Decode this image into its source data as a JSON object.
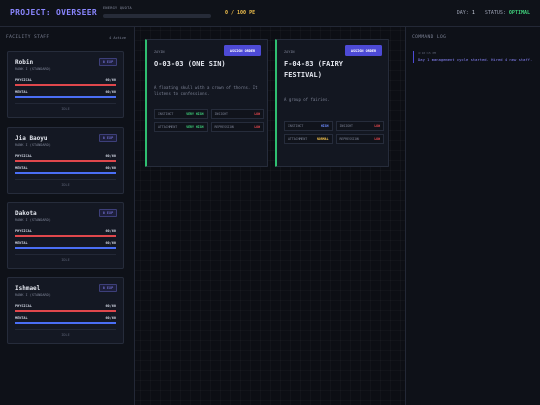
{
  "header": {
    "title": "PROJECT: OVERSEER",
    "quota_label": "ENERGY QUOTA",
    "quota_value": "0 / 100 PE",
    "quota_fraction": 0.0,
    "day_label": "DAY:",
    "day_value": "1",
    "status_label": "STATUS:",
    "status_value": "OPTIMAL"
  },
  "staff": {
    "heading": "FACILITY STAFF",
    "count": "4 Active",
    "members": [
      {
        "name": "Robin",
        "rank": "RANK I (STANDARD)",
        "exp": "0 EXP",
        "physical_label": "PHYSICAL",
        "physical": "60/60",
        "mental_label": "MENTAL",
        "mental": "60/60",
        "footer": "IDLE"
      },
      {
        "name": "Jia Baoyu",
        "rank": "RANK I (STANDARD)",
        "exp": "0 EXP",
        "physical_label": "PHYSICAL",
        "physical": "60/60",
        "mental_label": "MENTAL",
        "mental": "60/60",
        "footer": "IDLE"
      },
      {
        "name": "Dakota",
        "rank": "RANK I (STANDARD)",
        "exp": "0 EXP",
        "physical_label": "PHYSICAL",
        "physical": "60/60",
        "mental_label": "MENTAL",
        "mental": "60/60",
        "footer": "IDLE"
      },
      {
        "name": "Ishmael",
        "rank": "RANK I (STANDARD)",
        "exp": "0 EXP",
        "physical_label": "PHYSICAL",
        "physical": "60/60",
        "mental_label": "MENTAL",
        "mental": "60/60",
        "footer": "IDLE"
      }
    ]
  },
  "abnormalities": [
    {
      "tag": "ZAYIN",
      "assign_label": "ASSIGN ORDER",
      "name": "O-03-03 (ONE SIN)",
      "description": "A floating skull with a crown of thorns. It listens to confessions.",
      "work": [
        {
          "label": "INSTINCT",
          "value": "VERY HIGH",
          "tone": "g"
        },
        {
          "label": "INSIGHT",
          "value": "LOW",
          "tone": "r"
        },
        {
          "label": "ATTACHMENT",
          "value": "VERY HIGH",
          "tone": "g"
        },
        {
          "label": "REPRESSION",
          "value": "LOW",
          "tone": "r"
        }
      ]
    },
    {
      "tag": "ZAYIN",
      "assign_label": "ASSIGN ORDER",
      "name": "F-04-83 (FAIRY FESTIVAL)",
      "description": "A group of fairies.",
      "work": [
        {
          "label": "INSTINCT",
          "value": "HIGH",
          "tone": "b"
        },
        {
          "label": "INSIGHT",
          "value": "LOW",
          "tone": "r"
        },
        {
          "label": "ATTACHMENT",
          "value": "NORMAL",
          "tone": "y"
        },
        {
          "label": "REPRESSION",
          "value": "LOW",
          "tone": "r"
        }
      ]
    }
  ],
  "log": {
    "heading": "COMMAND LOG",
    "entries": [
      {
        "time": "4:10:15 PM",
        "text": "Day 1 management cycle started. Hired 4 new staff."
      }
    ]
  }
}
